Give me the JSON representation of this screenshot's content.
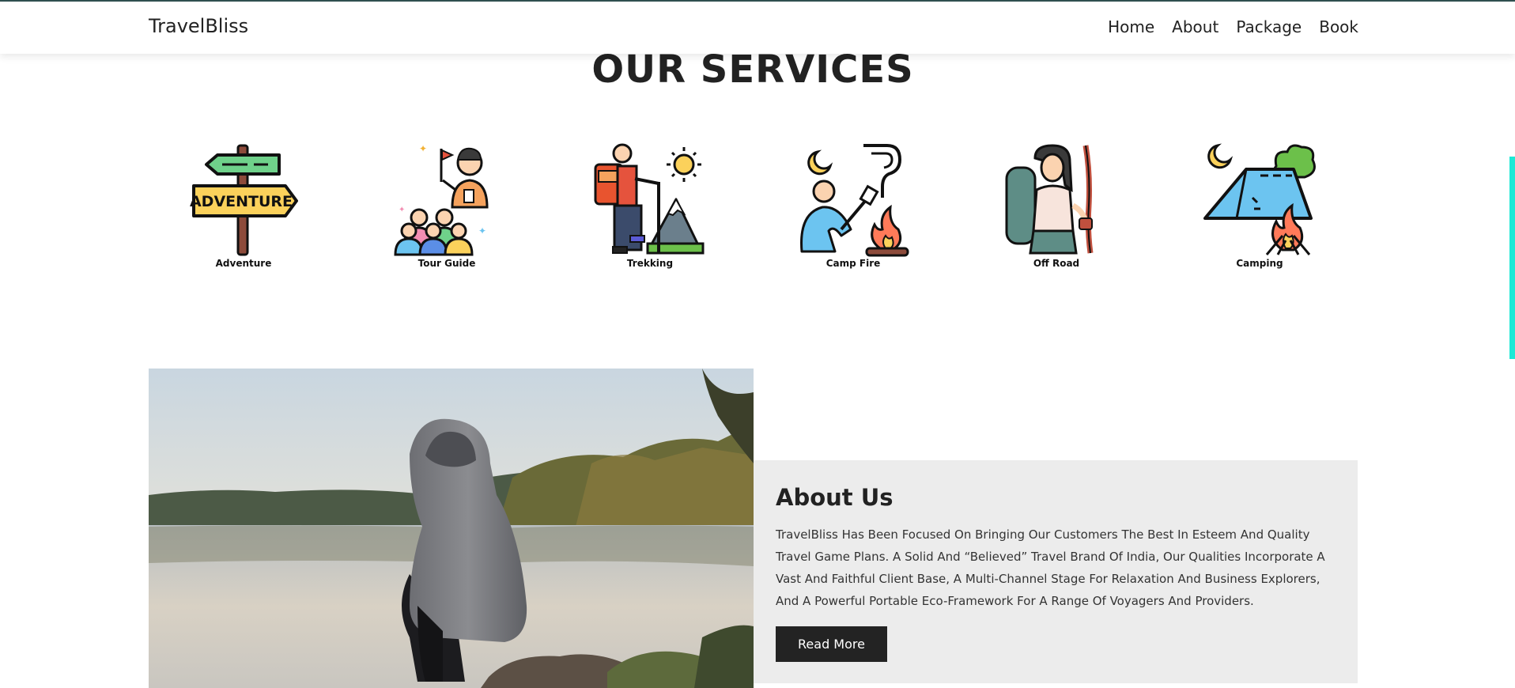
{
  "nav": {
    "brand": "TravelBliss",
    "links": [
      "Home",
      "About",
      "Package",
      "Book"
    ]
  },
  "services": {
    "title": "OUR SERVICES",
    "items": [
      {
        "label": "Adventure",
        "icon": "signpost-adventure-icon",
        "sign_text": "ADVENTURE"
      },
      {
        "label": "Tour Guide",
        "icon": "tour-guide-icon"
      },
      {
        "label": "Trekking",
        "icon": "trekking-icon"
      },
      {
        "label": "Camp Fire",
        "icon": "camp-fire-icon"
      },
      {
        "label": "Off Road",
        "icon": "off-road-icon"
      },
      {
        "label": "Camping",
        "icon": "camping-tent-icon"
      }
    ]
  },
  "about": {
    "title": "About Us",
    "text": "TravelBliss Has Been Focused On Bringing Our Customers The Best In Esteem And Quality Travel Game Plans. A Solid And “Believed” Travel Brand Of India, Our Qualities Incorporate A Vast And Faithful Client Base, A Multi-Channel Stage For Relaxation And Business Explorers, And A Powerful Portable Eco-Framework For A Range Of Voyagers And Providers.",
    "button": "Read More"
  },
  "colors": {
    "nav_border": "#2f4f4f",
    "panel_bg": "#ececec",
    "button_bg": "#232323",
    "scroll_accent": "#1de9d6"
  }
}
